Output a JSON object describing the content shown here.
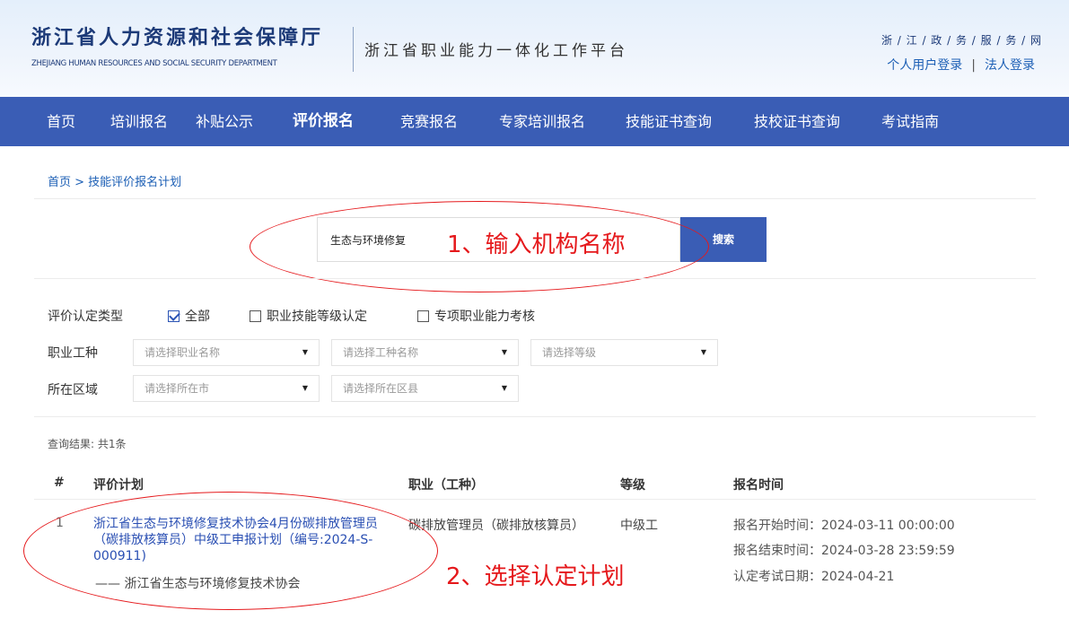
{
  "header": {
    "org_title": "浙江省人力资源和社会保障厅",
    "org_subtitle": "ZHEJIANG HUMAN RESOURCES AND SOCIAL SECURITY DEPARTMENT",
    "platform_title": "浙江省职业能力一体化工作平台",
    "gov_service": "浙 / 江 / 政 / 务 / 服 / 务 / 网",
    "personal_login": "个人用户登录",
    "login_separator": "|",
    "corporate_login": "法人登录"
  },
  "nav": {
    "items": [
      "首页",
      "培训报名",
      "补贴公示",
      "评价报名",
      "竞赛报名",
      "专家培训报名",
      "技能证书查询",
      "技校证书查询",
      "考试指南"
    ],
    "active_index": 3
  },
  "breadcrumb": "首页 > 技能评价报名计划",
  "search": {
    "value": "生态与环境修复",
    "button_label": "搜索"
  },
  "annotations": {
    "step1": "1、输入机构名称",
    "step2": "2、选择认定计划",
    "color": "#e5191c"
  },
  "filters": {
    "type_label": "评价认定类型",
    "type_options": [
      {
        "label": "全部",
        "checked": true
      },
      {
        "label": "职业技能等级认定",
        "checked": false
      },
      {
        "label": "专项职业能力考核",
        "checked": false
      }
    ],
    "occupation_label": "职业工种",
    "occupation_selects": [
      "请选择职业名称",
      "请选择工种名称",
      "请选择等级"
    ],
    "region_label": "所在区域",
    "region_selects": [
      "请选择所在市",
      "请选择所在区县"
    ],
    "dropdown_icon": "triangle-down-icon"
  },
  "results": {
    "count_text": "查询结果: 共1条",
    "columns": [
      "#",
      "评价计划",
      "职业（工种）",
      "等级",
      "报名时间"
    ],
    "rows": [
      {
        "index": "1",
        "plan": "浙江省生态与环境修复技术协会4月份碳排放管理员（碳排放核算员）中级工申报计划（编号:2024-S-000911)",
        "organization": "—— 浙江省生态与环境修复技术协会",
        "occupation": "碳排放管理员（碳排放核算员）",
        "level": "中级工",
        "times": [
          "报名开始时间：2024-03-11 00:00:00",
          "报名结束时间：2024-03-28 23:59:59",
          "认定考试日期：2024-04-21"
        ]
      }
    ]
  },
  "colors": {
    "nav_bg": "#3a5db5",
    "link": "#2a4fb3",
    "brand": "#1c3a78"
  }
}
